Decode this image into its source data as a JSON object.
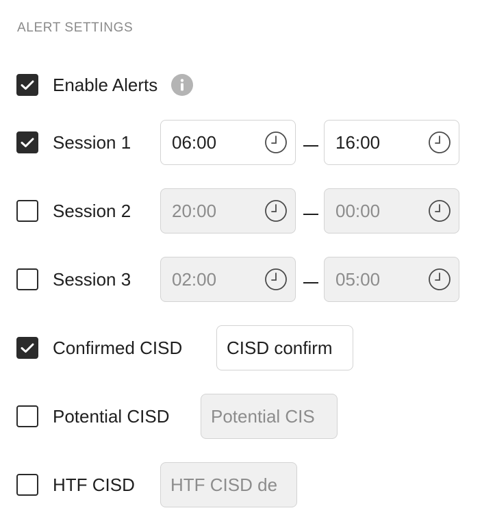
{
  "section": {
    "title": "ALERT SETTINGS"
  },
  "enable_alerts": {
    "label": "Enable Alerts",
    "checked": true
  },
  "sessions": [
    {
      "label": "Session 1",
      "checked": true,
      "start": "06:00",
      "end": "16:00"
    },
    {
      "label": "Session 2",
      "checked": false,
      "start": "20:00",
      "end": "00:00"
    },
    {
      "label": "Session 3",
      "checked": false,
      "start": "02:00",
      "end": "05:00"
    }
  ],
  "cisd": [
    {
      "label": "Confirmed CISD",
      "checked": true,
      "value": "CISD confirm"
    },
    {
      "label": "Potential CISD",
      "checked": false,
      "value": "Potential CIS"
    },
    {
      "label": "HTF CISD",
      "checked": false,
      "value": "HTF CISD de"
    }
  ],
  "colors": {
    "checkbox_checked": "#2b2b2b",
    "field_border": "#d3d3d3",
    "field_disabled_bg": "#f0f0f0",
    "section_title": "#8a8a8a",
    "info_icon": "#b4b4b4"
  },
  "icons": {
    "check": "check-icon",
    "clock": "clock-icon",
    "info": "info-icon"
  }
}
